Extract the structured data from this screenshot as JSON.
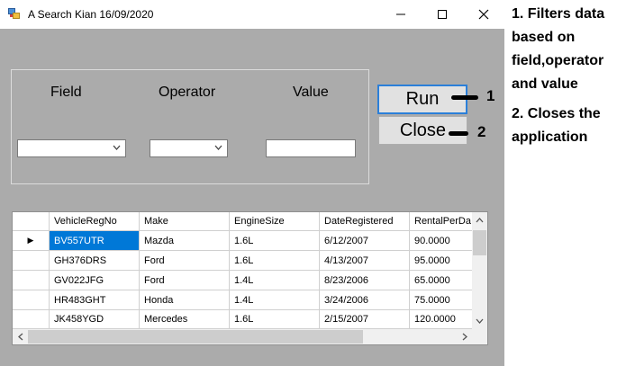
{
  "window": {
    "title": "A Search Kian 16/09/2020",
    "icon": "app-window-icon"
  },
  "titlebar_controls": [
    "minimize-icon",
    "maximize-icon",
    "close-icon"
  ],
  "filter": {
    "field_label": "Field",
    "operator_label": "Operator",
    "value_label": "Value",
    "field_value": "",
    "operator_value": "",
    "value_text": ""
  },
  "buttons": {
    "run": "Run",
    "close": "Close"
  },
  "annotations": {
    "run_number": "1",
    "close_number": "2"
  },
  "grid": {
    "columns": [
      "VehicleRegNo",
      "Make",
      "EngineSize",
      "DateRegistered",
      "RentalPerDa"
    ],
    "rows": [
      [
        "BV557UTR",
        "Mazda",
        "1.6L",
        "6/12/2007",
        "90.0000"
      ],
      [
        "GH376DRS",
        "Ford",
        "1.6L",
        "4/13/2007",
        "95.0000"
      ],
      [
        "GV022JFG",
        "Ford",
        "1.4L",
        "8/23/2006",
        "65.0000"
      ],
      [
        "HR483GHT",
        "Honda",
        "1.4L",
        "3/24/2006",
        "75.0000"
      ],
      [
        "JK458YGD",
        "Mercedes",
        "1.6L",
        "2/15/2007",
        "120.0000"
      ]
    ],
    "current_row_indicator": "▶"
  },
  "notes": {
    "note1": "1. Filters data based on field,operator and value",
    "note2": "2. Closes the application"
  },
  "colors": {
    "window_bg": "#ababab",
    "selection": "#0078d7",
    "run_border": "#2b7fd9"
  }
}
